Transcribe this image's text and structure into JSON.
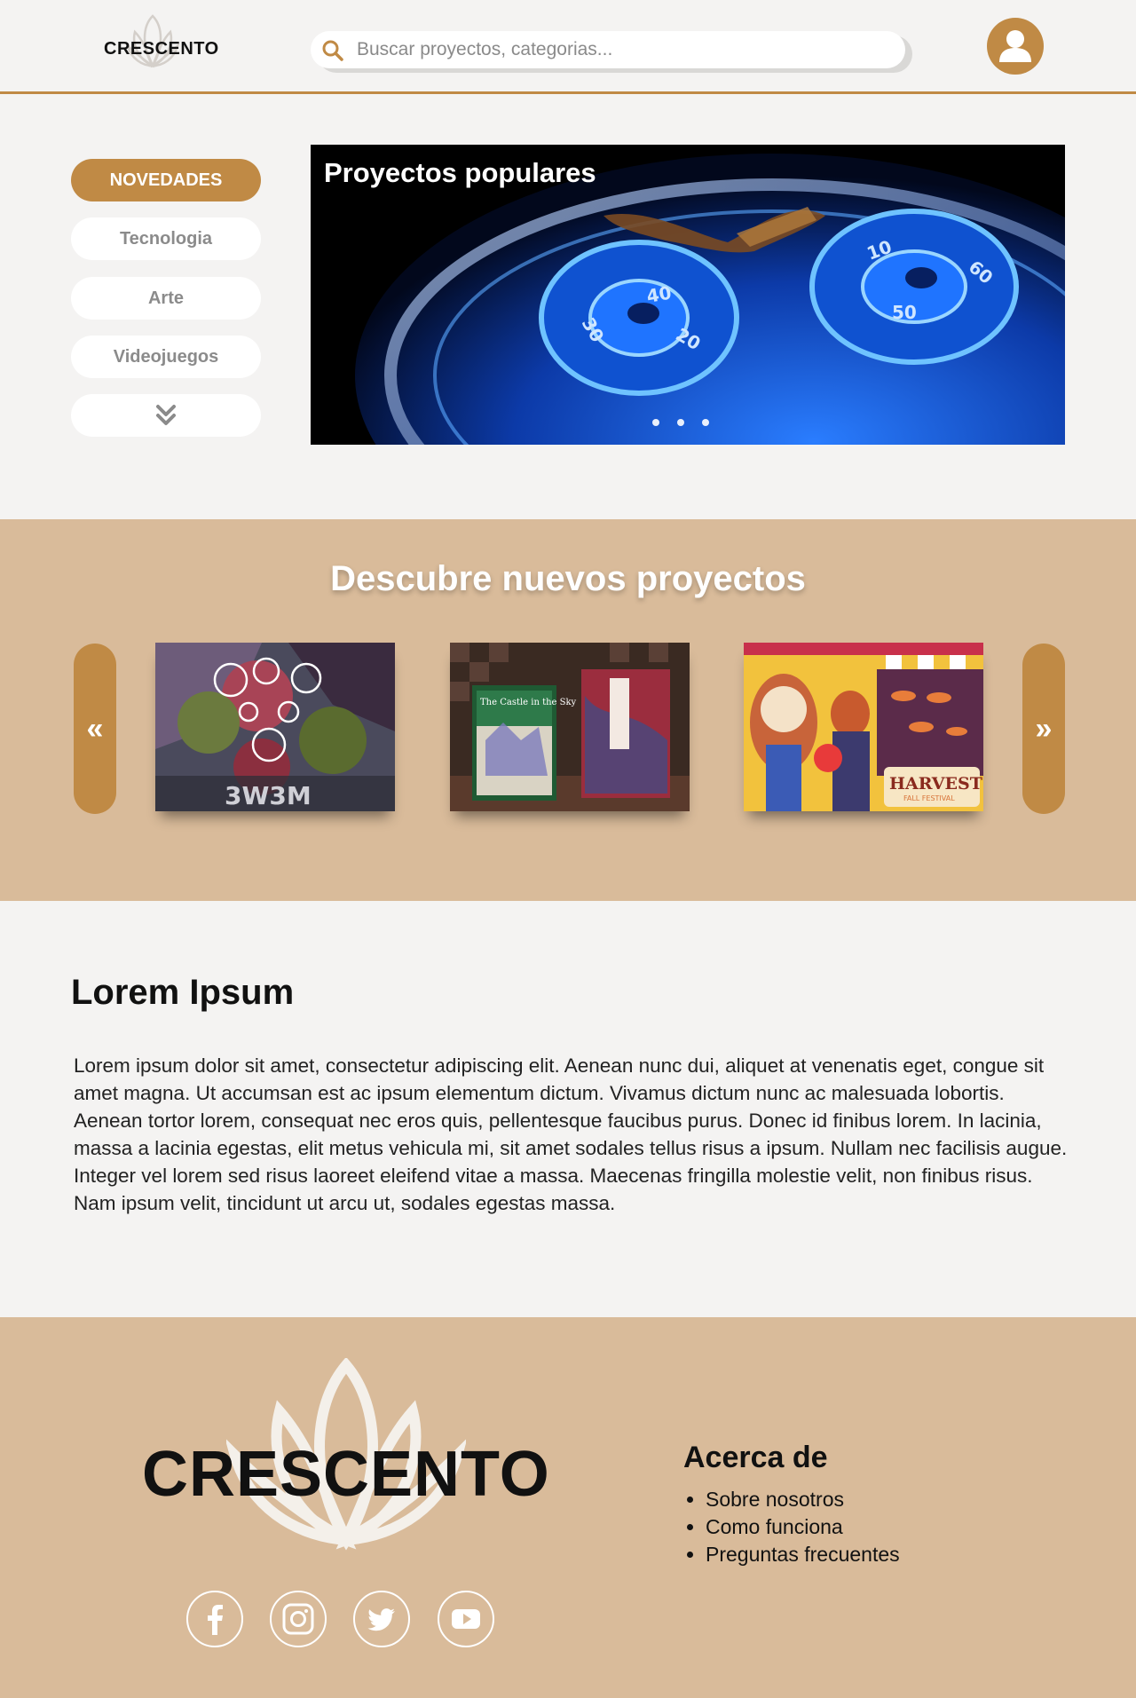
{
  "header": {
    "logo_text": "CRESCENTO",
    "search_placeholder": "Buscar proyectos, categorias..."
  },
  "categories": [
    "NOVEDADES",
    "Tecnologia",
    "Arte",
    "Videojuegos"
  ],
  "hero": {
    "title": "Proyectos populares",
    "slides": 3
  },
  "discover": {
    "title": "Descubre nuevos proyectos",
    "prev_label": "«",
    "next_label": "»",
    "cards": [
      {
        "caption": "3W3M"
      },
      {
        "caption": "The Castle in the Sky"
      },
      {
        "caption": "HARVEST",
        "subcaption": "FALL FESTIVAL"
      }
    ]
  },
  "content": {
    "title": "Lorem Ipsum",
    "body": "Lorem ipsum dolor sit amet, consectetur adipiscing elit. Aenean nunc dui, aliquet at venenatis eget, congue sit amet magna. Ut accumsan est ac ipsum elementum dictum. Vivamus dictum nunc ac malesuada lobortis. Aenean tortor lorem, consequat nec eros quis, pellentesque faucibus purus. Donec id finibus lorem. In lacinia, massa a lacinia egestas, elit metus vehicula mi, sit amet sodales tellus risus a ipsum. Nullam nec facilisis augue. Integer vel lorem sed risus laoreet eleifend vitae a massa. Maecenas fringilla molestie velit, non finibus risus. Nam ipsum velit, tincidunt ut arcu ut, sodales egestas massa."
  },
  "footer": {
    "logo_text": "CRESCENTO",
    "about_title": "Acerca de",
    "about_links": [
      "Sobre nosotros",
      "Como funciona",
      "Preguntas frecuentes"
    ],
    "social": [
      "facebook-icon",
      "instagram-icon",
      "twitter-icon",
      "youtube-icon"
    ]
  },
  "colors": {
    "accent": "#c08a45",
    "band": "#d9bb9a",
    "background": "#f4f3f2"
  }
}
